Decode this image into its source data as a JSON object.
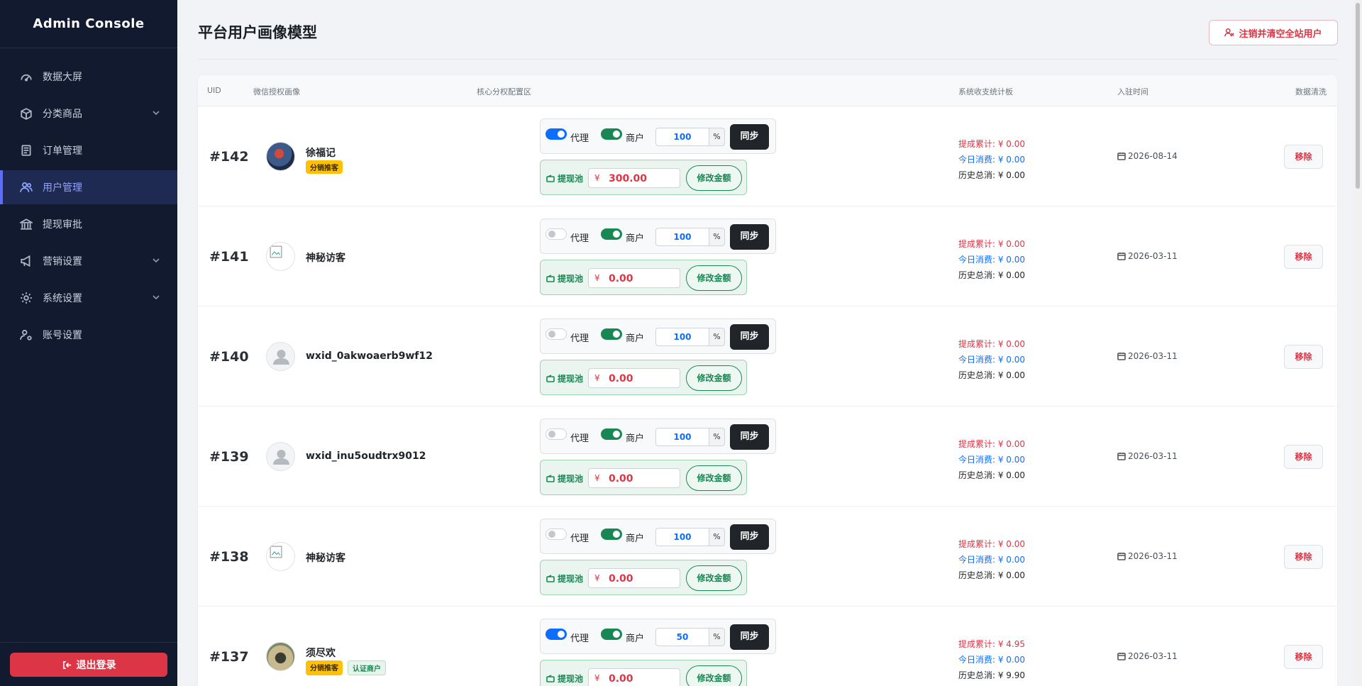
{
  "app": {
    "title": "Admin Console"
  },
  "sidebar": {
    "items": [
      {
        "label": "数据大屏",
        "icon": "dashboard-icon",
        "active": false,
        "has_children": false
      },
      {
        "label": "分类商品",
        "icon": "box-icon",
        "active": false,
        "has_children": true
      },
      {
        "label": "订单管理",
        "icon": "receipt-icon",
        "active": false,
        "has_children": false
      },
      {
        "label": "用户管理",
        "icon": "users-icon",
        "active": true,
        "has_children": false
      },
      {
        "label": "提现审批",
        "icon": "bank-icon",
        "active": false,
        "has_children": false
      },
      {
        "label": "营销设置",
        "icon": "megaphone-icon",
        "active": false,
        "has_children": true
      },
      {
        "label": "系统设置",
        "icon": "gear-icon",
        "active": false,
        "has_children": true
      },
      {
        "label": "账号设置",
        "icon": "user-gear-icon",
        "active": false,
        "has_children": false
      }
    ],
    "logout_label": "退出登录"
  },
  "header": {
    "title": "平台用户画像模型",
    "clear_button_label": "注销并清空全站用户"
  },
  "table": {
    "columns": [
      "UID",
      "微信授权画像",
      "核心分权配置区",
      "系统收支统计板",
      "入驻时间",
      "数据清洗"
    ],
    "labels": {
      "agent": "代理",
      "merchant": "商户",
      "pct": "%",
      "sync": "同步",
      "pool": "提现池",
      "currency": "¥",
      "edit_amount": "修改金额",
      "remove": "移除"
    },
    "rows": [
      {
        "uid": "#142",
        "name": "徐福记",
        "avatar": "photo1",
        "badges": [
          "分销推客"
        ],
        "agent_on": true,
        "merchant_on": true,
        "rate": "100",
        "pool": "300.00",
        "stat_commission": "提成累计: ¥ 0.00",
        "stat_today": "今日消费: ¥ 0.00",
        "stat_total": "历史总消: ¥ 0.00",
        "date": "2026-08-14"
      },
      {
        "uid": "#141",
        "name": "神秘访客",
        "avatar": "broken",
        "badges": [],
        "agent_on": false,
        "merchant_on": true,
        "rate": "100",
        "pool": "0.00",
        "stat_commission": "提成累计: ¥ 0.00",
        "stat_today": "今日消费: ¥ 0.00",
        "stat_total": "历史总消: ¥ 0.00",
        "date": "2026-03-11"
      },
      {
        "uid": "#140",
        "name": "wxid_0akwoaerb9wf12",
        "avatar": "default",
        "badges": [],
        "agent_on": false,
        "merchant_on": true,
        "rate": "100",
        "pool": "0.00",
        "stat_commission": "提成累计: ¥ 0.00",
        "stat_today": "今日消费: ¥ 0.00",
        "stat_total": "历史总消: ¥ 0.00",
        "date": "2026-03-11"
      },
      {
        "uid": "#139",
        "name": "wxid_inu5oudtrx9012",
        "avatar": "default",
        "badges": [],
        "agent_on": false,
        "merchant_on": true,
        "rate": "100",
        "pool": "0.00",
        "stat_commission": "提成累计: ¥ 0.00",
        "stat_today": "今日消费: ¥ 0.00",
        "stat_total": "历史总消: ¥ 0.00",
        "date": "2026-03-11"
      },
      {
        "uid": "#138",
        "name": "神秘访客",
        "avatar": "broken",
        "badges": [],
        "agent_on": false,
        "merchant_on": true,
        "rate": "100",
        "pool": "0.00",
        "stat_commission": "提成累计: ¥ 0.00",
        "stat_today": "今日消费: ¥ 0.00",
        "stat_total": "历史总消: ¥ 0.00",
        "date": "2026-03-11"
      },
      {
        "uid": "#137",
        "name": "须尽欢",
        "avatar": "photo2",
        "badges": [
          "分销推客",
          "认证商户"
        ],
        "agent_on": true,
        "merchant_on": true,
        "rate": "50",
        "pool": "0.00",
        "stat_commission": "提成累计: ¥ 4.95",
        "stat_today": "今日消费: ¥ 0.00",
        "stat_total": "历史总消: ¥ 9.90",
        "date": "2026-03-11"
      }
    ]
  },
  "colors": {
    "sidebar_bg": "#111a2e",
    "accent": "#5b6cff",
    "danger": "#dc3545",
    "success": "#198754",
    "primary": "#0d6efd"
  }
}
